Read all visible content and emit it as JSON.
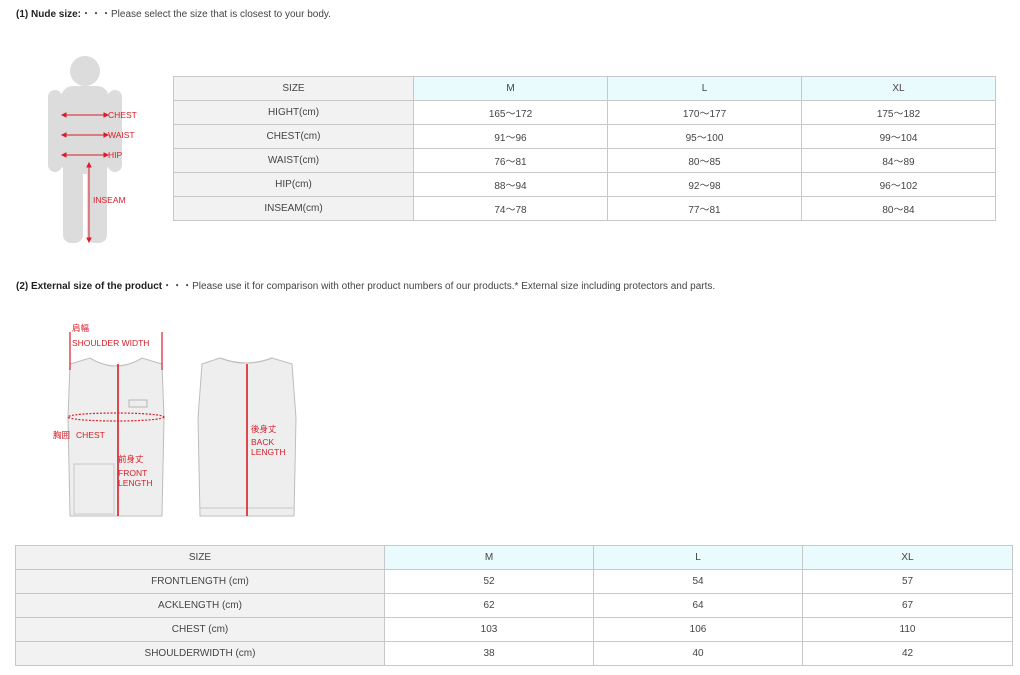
{
  "section1": {
    "title": "(1) Nude size:",
    "note": "・・・Please select the size that is closest to your body."
  },
  "body_figure": {
    "labels": {
      "chest": "CHEST",
      "waist": "WAIST",
      "hip": "HIP",
      "inseam": "INSEAM"
    },
    "accent_color": "#d81e2a",
    "figure_color": "#dcdcdc"
  },
  "table1": {
    "headers": [
      "SIZE",
      "M",
      "L",
      "XL"
    ],
    "rows": [
      [
        "HIGHT(cm)",
        "165～172",
        "170～177",
        "175～182"
      ],
      [
        "CHEST(cm)",
        "91～96",
        "95～100",
        "99～104"
      ],
      [
        "WAIST(cm)",
        "76～81",
        "80～85",
        "84～89"
      ],
      [
        "HIP(cm)",
        "88～94",
        "92～98",
        "96～102"
      ],
      [
        "INSEAM(cm)",
        "74～78",
        "77～81",
        "80～84"
      ]
    ]
  },
  "section2": {
    "title": "(2) External size of the product",
    "note": "・・・Please use it for comparison with other product numbers of our products.* External size including protectors and parts."
  },
  "vest_figure": {
    "shoulder_jp": "肩幅",
    "shoulder_en": "SHOULDER WIDTH",
    "chest_jp": "胸囲",
    "chest_en": "CHEST",
    "front_jp": "前身丈",
    "front_en_1": "FRONT",
    "front_en_2": "LENGTH",
    "back_jp": "後身丈",
    "back_en_1": "BACK",
    "back_en_2": "LENGTH"
  },
  "table2": {
    "headers": [
      "SIZE",
      "M",
      "L",
      "XL"
    ],
    "rows": [
      [
        "FRONTLENGTH (cm)",
        "52",
        "54",
        "57"
      ],
      [
        "ACKLENGTH (cm)",
        "62",
        "64",
        "67"
      ],
      [
        "CHEST (cm)",
        "103",
        "106",
        "110"
      ],
      [
        "SHOULDERWIDTH (cm)",
        "38",
        "40",
        "42"
      ]
    ]
  },
  "colors": {
    "header_fill": "#e9fbfd",
    "label_fill": "#f2f2f2",
    "border": "#c8c8c8"
  }
}
